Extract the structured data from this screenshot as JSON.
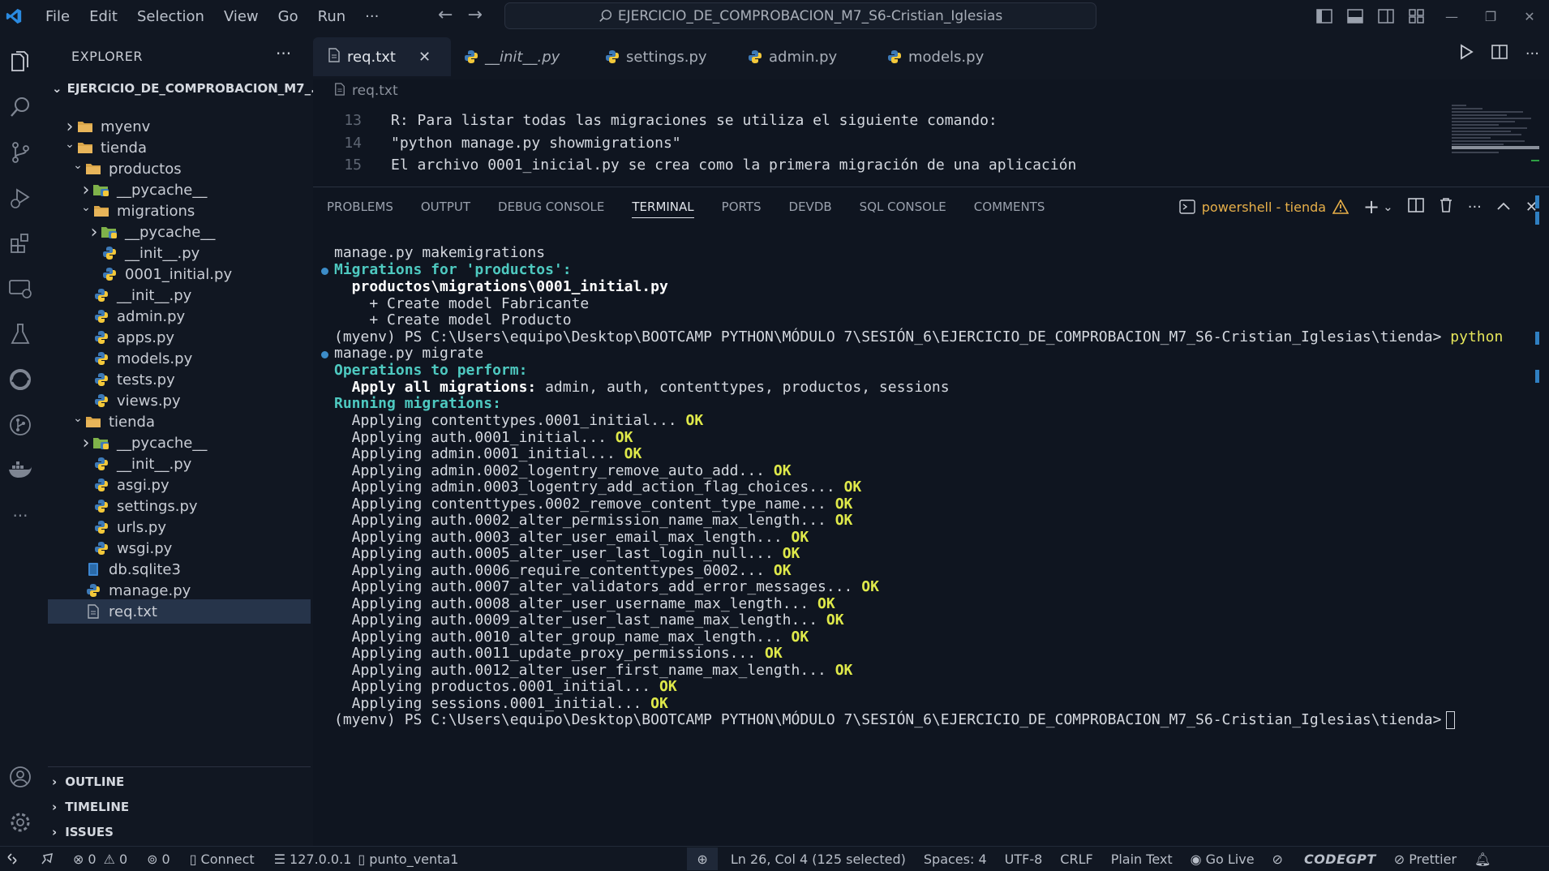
{
  "menu": [
    "File",
    "Edit",
    "Selection",
    "View",
    "Go",
    "Run",
    "···"
  ],
  "command_center": "EJERCICIO_DE_COMPROBACION_M7_S6-Cristian_Iglesias",
  "sidebar": {
    "title": "EXPLORER",
    "more": "···",
    "root": "EJERCICIO_DE_COMPROBACION_M7_...",
    "items": [
      {
        "label": "myenv"
      },
      {
        "label": "tienda"
      },
      {
        "label": "productos"
      },
      {
        "label": "__pycache__"
      },
      {
        "label": "migrations"
      },
      {
        "label": "__pycache__"
      },
      {
        "label": "__init__.py"
      },
      {
        "label": "0001_initial.py"
      },
      {
        "label": "__init__.py"
      },
      {
        "label": "admin.py"
      },
      {
        "label": "apps.py"
      },
      {
        "label": "models.py"
      },
      {
        "label": "tests.py"
      },
      {
        "label": "views.py"
      },
      {
        "label": "tienda"
      },
      {
        "label": "__pycache__"
      },
      {
        "label": "__init__.py"
      },
      {
        "label": "asgi.py"
      },
      {
        "label": "settings.py"
      },
      {
        "label": "urls.py"
      },
      {
        "label": "wsgi.py"
      },
      {
        "label": "db.sqlite3"
      },
      {
        "label": "manage.py"
      },
      {
        "label": "req.txt"
      }
    ],
    "sections": [
      "OUTLINE",
      "TIMELINE",
      "ISSUES"
    ]
  },
  "tabs": [
    {
      "label": "req.txt",
      "active": true
    },
    {
      "label": "__init__.py"
    },
    {
      "label": "settings.py"
    },
    {
      "label": "admin.py"
    },
    {
      "label": "models.py"
    }
  ],
  "breadcrumb": "req.txt",
  "editor_lines": [
    {
      "num": "13",
      "text": "R: Para listar todas las migraciones se utiliza el siguiente comando:"
    },
    {
      "num": "14",
      "text": "\"python manage.py showmigrations\""
    },
    {
      "num": "15",
      "text": "El archivo 0001_inicial.py se crea como la primera migración de una aplicación"
    }
  ],
  "panel": {
    "tabs": [
      "PROBLEMS",
      "OUTPUT",
      "DEBUG CONSOLE",
      "TERMINAL",
      "PORTS",
      "DEVDB",
      "SQL CONSOLE",
      "COMMENTS"
    ],
    "active_tab": "TERMINAL",
    "shell": "powershell - tienda"
  },
  "terminal": {
    "line1": "manage.py makemigrations",
    "line2": "Migrations for 'productos':",
    "line3": "  productos\\migrations\\0001_initial.py",
    "line4": "    + Create model Fabricante",
    "line5": "    + Create model Producto",
    "prompt_prefix": "(myenv) PS C:\\Users\\equipo\\Desktop\\BOOTCAMP PYTHON\\MÓDULO 7\\SESIÓN_6\\EJERCICIO_DE_COMPROBACION_M7_S6-Cristian_Iglesias\\tienda>",
    "prompt_cmd": " python",
    "line7": "manage.py migrate",
    "line8": "Operations to perform:",
    "apply_label": "  Apply all migrations:",
    "apply_list": " admin, auth, contenttypes, productos, sessions",
    "running": "Running migrations:",
    "ok": "OK",
    "migrations": [
      "  Applying contenttypes.0001_initial...",
      "  Applying auth.0001_initial...",
      "  Applying admin.0001_initial...",
      "  Applying admin.0002_logentry_remove_auto_add...",
      "  Applying admin.0003_logentry_add_action_flag_choices...",
      "  Applying contenttypes.0002_remove_content_type_name...",
      "  Applying auth.0002_alter_permission_name_max_length...",
      "  Applying auth.0003_alter_user_email_max_length...",
      "  Applying auth.0005_alter_user_last_login_null...",
      "  Applying auth.0006_require_contenttypes_0002...",
      "  Applying auth.0007_alter_validators_add_error_messages...",
      "  Applying auth.0008_alter_user_username_max_length...",
      "  Applying auth.0009_alter_user_last_name_max_length...",
      "  Applying auth.0010_alter_group_name_max_length...",
      "  Applying auth.0011_update_proxy_permissions...",
      "  Applying auth.0012_alter_user_first_name_max_length...",
      "  Applying productos.0001_initial...",
      "  Applying sessions.0001_initial..."
    ]
  },
  "statusbar": {
    "errors": "0",
    "warnings": "0",
    "ports": "0",
    "connect": "Connect",
    "db_host": "127.0.0.1",
    "db_name": "punto_venta1",
    "position": "Ln 26, Col 4 (125 selected)",
    "spaces": "Spaces: 4",
    "encoding": "UTF-8",
    "eol": "CRLF",
    "language": "Plain Text",
    "golive": "Go Live",
    "codegpt": "CODEGPT",
    "prettier": "Prettier"
  },
  "colors": {
    "accent": "#3c8cc8",
    "terminal_ok": "#dfe94a",
    "terminal_cyan": "#4ec9c0",
    "shell_warning": "#e8b049",
    "python_blue": "#3d7ab8",
    "python_yellow": "#f3c83a",
    "folder": "#d9a548"
  }
}
